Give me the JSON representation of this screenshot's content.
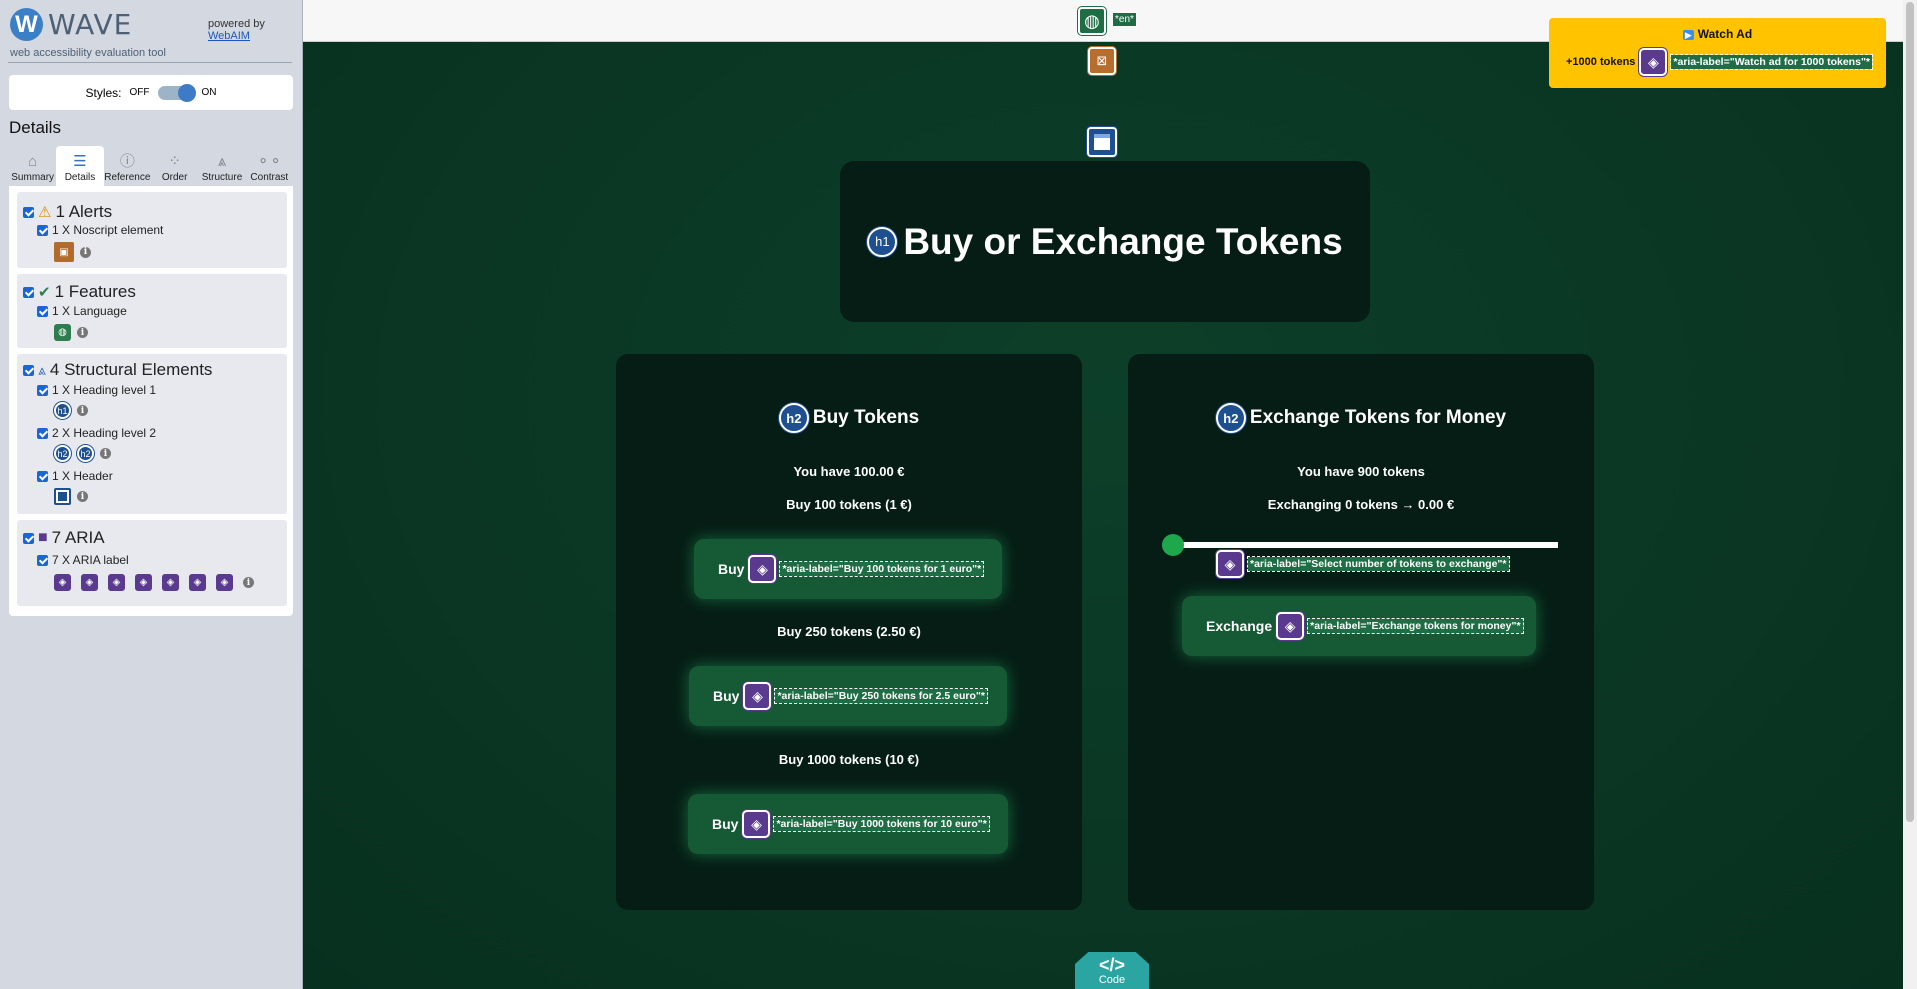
{
  "wave": {
    "logo_letter": "W",
    "name": "WAVE",
    "subtitle": "web accessibility evaluation tool",
    "powered_by": "powered by",
    "webaim": "WebAIM",
    "styles_label": "Styles:",
    "styles_off": "OFF",
    "styles_on": "ON",
    "details_heading": "Details",
    "tabs": [
      {
        "label": "Summary",
        "icon": "home-icon"
      },
      {
        "label": "Details",
        "icon": "list-icon"
      },
      {
        "label": "Reference",
        "icon": "info-icon"
      },
      {
        "label": "Order",
        "icon": "order-icon"
      },
      {
        "label": "Structure",
        "icon": "structure-icon"
      },
      {
        "label": "Contrast",
        "icon": "contrast-icon"
      }
    ],
    "alerts": {
      "title": "1 Alerts",
      "item": "1 X Noscript element"
    },
    "features": {
      "title": "1 Features",
      "item": "1 X Language"
    },
    "structure": {
      "title": "4 Structural Elements",
      "h1": "1 X Heading level 1",
      "h2": "2 X Heading level 2",
      "header": "1 X Header"
    },
    "aria": {
      "title": "7 ARIA",
      "item": "7 X ARIA label"
    }
  },
  "page": {
    "lang_code": "*en*",
    "watch_ad": {
      "title": "Watch Ad",
      "reward": "+1000 tokens",
      "aria": "*aria-label=\"Watch ad for 1000 tokens\"*"
    },
    "title": "Buy or Exchange Tokens",
    "h1_badge": "h1",
    "h2_badge": "h2",
    "buy": {
      "heading": "Buy Tokens",
      "have_prefix": "You have ",
      "have_value": "100.00 €",
      "options": [
        {
          "label": "Buy 100 tokens (1 €)",
          "button": "Buy",
          "aria": "*aria-label=\"Buy 100 tokens for 1 euro\"*"
        },
        {
          "label": "Buy 250 tokens (2.50 €)",
          "button": "Buy",
          "aria": "*aria-label=\"Buy 250 tokens for 2.5 euro\"*"
        },
        {
          "label": "Buy 1000 tokens (10 €)",
          "button": "Buy",
          "aria": "*aria-label=\"Buy 1000 tokens for 10 euro\"*"
        }
      ]
    },
    "exchange": {
      "heading": "Exchange Tokens for Money",
      "have_prefix": "You have ",
      "have_value": "900 tokens",
      "exchanging": "Exchanging 0 tokens → 0.00 €",
      "slider_value": 0,
      "slider_aria": "*aria-label=\"Select number of tokens to exchange\"*",
      "button": "Exchange",
      "button_aria": "*aria-label=\"Exchange tokens for money\"*"
    },
    "code_label": "Code",
    "code_icon": "</>"
  }
}
